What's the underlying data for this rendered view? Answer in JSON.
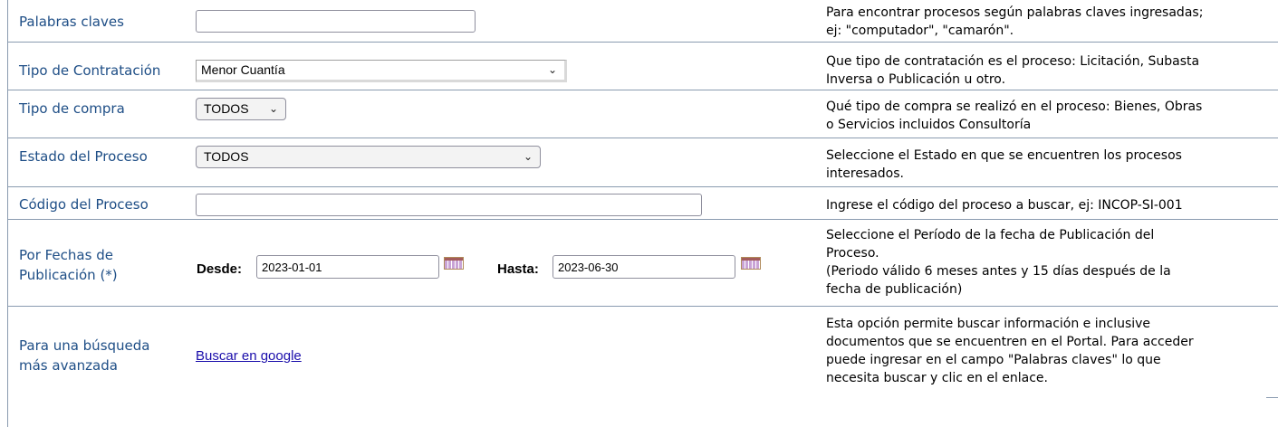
{
  "rows": {
    "keywords": {
      "label": "Palabras claves",
      "value": "",
      "help_lines": [
        "Para encontrar procesos según palabras claves ingresadas;",
        "ej: \"computador\", \"camarón\"."
      ]
    },
    "contract_type": {
      "label": "Tipo de Contratación",
      "selected": "Menor Cuantía",
      "help_lines": [
        "Que tipo de contratación es el proceso: Licitación, Subasta",
        "Inversa o Publicación u otro."
      ]
    },
    "purchase_type": {
      "label": "Tipo de compra",
      "selected": "TODOS",
      "help_lines": [
        "Qué tipo de compra se realizó en el proceso: Bienes, Obras",
        "o Servicios incluidos Consultoría"
      ]
    },
    "process_state": {
      "label": "Estado del Proceso",
      "selected": "TODOS",
      "help_lines": [
        "Seleccione el Estado en que se encuentren los procesos",
        "interesados."
      ]
    },
    "process_code": {
      "label": "Código del Proceso",
      "value": "",
      "help_lines": [
        "Ingrese el código del proceso a buscar, ej: INCOP-SI-001"
      ]
    },
    "dates": {
      "label_lines": [
        "Por Fechas de",
        "Publicación (*)"
      ],
      "from_label": "Desde:",
      "from_value": "2023-01-01",
      "to_label": "Hasta:",
      "to_value": "2023-06-30",
      "help_lines": [
        "Seleccione el Período de la fecha de Publicación del",
        "Proceso.",
        "(Periodo válido 6 meses antes y 15 días después de la",
        "fecha de publicación)"
      ]
    },
    "advanced": {
      "label_lines": [
        "Para una búsqueda",
        "más avanzada"
      ],
      "link": "Buscar en google",
      "help_lines": [
        "Esta opción permite buscar información e inclusive",
        "documentos que se encuentren en el Portal. Para acceder",
        "puede ingresar en el campo \"Palabras claves\" lo que",
        "necesita buscar y clic en el enlace."
      ]
    }
  },
  "icons": {
    "dropdown": "chevron-down-icon",
    "calendar": "calendar-icon"
  }
}
